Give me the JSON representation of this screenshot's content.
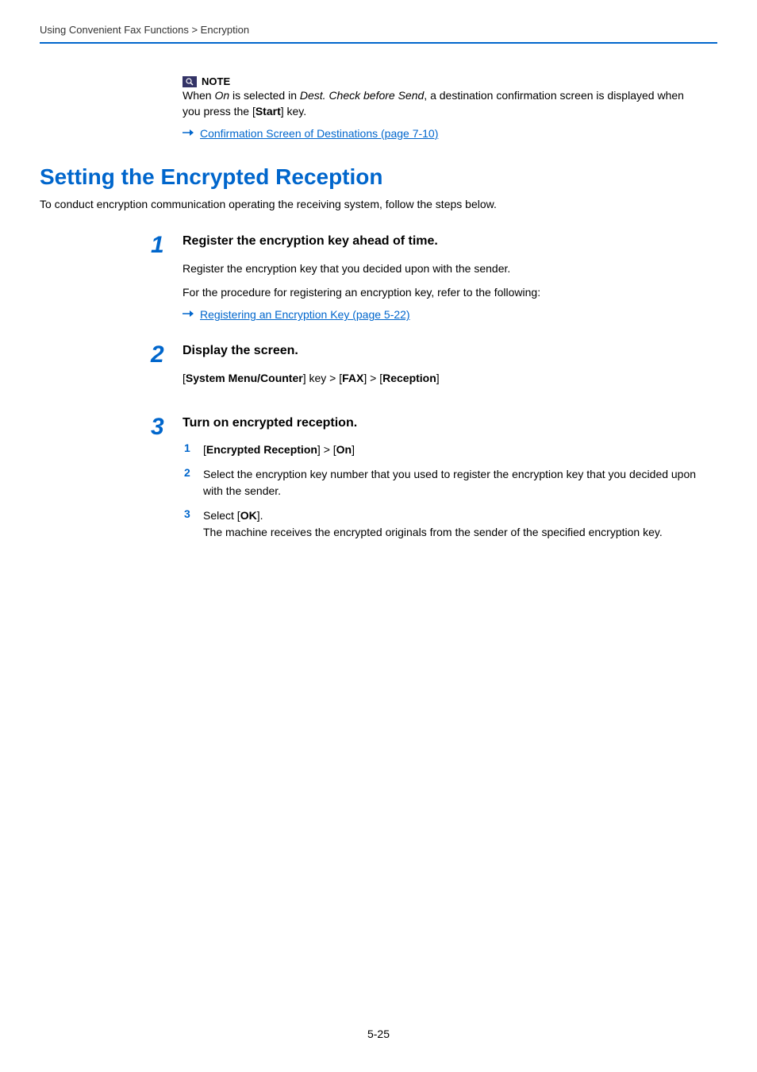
{
  "header": {
    "breadcrumb": "Using Convenient Fax Functions > Encryption"
  },
  "note": {
    "label": "NOTE",
    "body_pre": "When ",
    "body_on": "On",
    "body_mid1": " is selected in ",
    "body_dest": "Dest. Check before Send",
    "body_mid2": ", a destination confirmation screen is displayed when you press the [",
    "body_start": "Start",
    "body_end": "] key.",
    "link": "Confirmation Screen of Destinations (page 7-10)"
  },
  "heading": "Setting the Encrypted Reception",
  "intro": "To conduct encryption communication operating the receiving system, follow the steps below.",
  "step1": {
    "num": "1",
    "title": "Register the encryption key ahead of time.",
    "line1": "Register the encryption key that you decided upon with the sender.",
    "line2": "For the procedure for registering an encryption key, refer to the following:",
    "link": "Registering an Encryption Key (page 5-22)"
  },
  "step2": {
    "num": "2",
    "title": "Display the screen.",
    "path_open": "[",
    "path_smc": "System Menu/Counter",
    "path_mid1": "] key > [",
    "path_fax": "FAX",
    "path_mid2": "] > [",
    "path_rec": "Reception",
    "path_close": "]"
  },
  "step3": {
    "num": "3",
    "title": "Turn on encrypted reception.",
    "sub1": {
      "num": "1",
      "open": "[",
      "er": "Encrypted Reception",
      "mid": "] > [",
      "on": "On",
      "close": "]"
    },
    "sub2": {
      "num": "2",
      "text": "Select the encryption key number that you used to register the encryption key that you decided upon with the sender."
    },
    "sub3": {
      "num": "3",
      "pre": "Select [",
      "ok": "OK",
      "post": "].",
      "text2": "The machine receives the encrypted originals from the sender of the specified encryption key."
    }
  },
  "pageNumber": "5-25"
}
